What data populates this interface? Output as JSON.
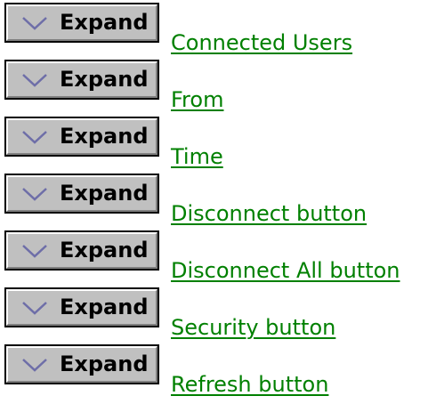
{
  "rows": [
    {
      "button_label": "Expand",
      "button_icon": "chevron-down-icon",
      "link_text": "Connected Users"
    },
    {
      "button_label": "Expand",
      "button_icon": "chevron-down-icon",
      "link_text": "From"
    },
    {
      "button_label": "Expand",
      "button_icon": "chevron-down-icon",
      "link_text": "Time"
    },
    {
      "button_label": "Expand",
      "button_icon": "chevron-down-icon",
      "link_text": "Disconnect button"
    },
    {
      "button_label": "Expand",
      "button_icon": "chevron-down-icon",
      "link_text": "Disconnect All button"
    },
    {
      "button_label": "Expand",
      "button_icon": "chevron-down-icon",
      "link_text": "Security button"
    },
    {
      "button_label": "Expand",
      "button_icon": "chevron-down-icon",
      "link_text": "Refresh button"
    }
  ],
  "colors": {
    "button_face": "#c0c0c0",
    "chevron": "#6e6ea8",
    "link": "#008000"
  }
}
